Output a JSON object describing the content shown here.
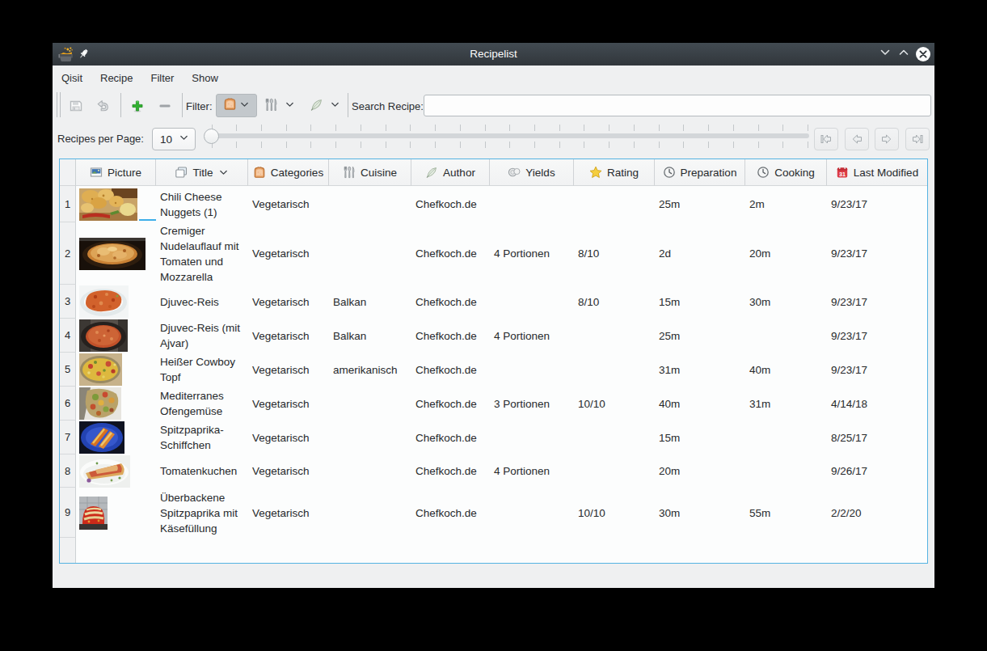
{
  "window": {
    "title": "Recipelist",
    "app_icon": "cooking-pot-icon",
    "buttons": {
      "minimize": "chevron-down-icon",
      "maximize": "chevron-up-icon",
      "close": "close-x-icon"
    }
  },
  "menu": {
    "items": [
      "Qisit",
      "Recipe",
      "Filter",
      "Show"
    ]
  },
  "toolbar": {
    "save_icon": "save-floppy-icon",
    "undo_icon": "undo-arrow-icon",
    "add_icon": "add-plus-icon",
    "remove_icon": "remove-minus-icon",
    "filter_label": "Filter:",
    "filter_buttons": [
      {
        "icon": "bread-icon",
        "pressed": true
      },
      {
        "icon": "cutlery-icon",
        "pressed": false
      },
      {
        "icon": "feather-icon",
        "pressed": false
      }
    ],
    "search_label": "Search Recipe:",
    "search_value": "",
    "search_placeholder": ""
  },
  "pager": {
    "label": "Recipes per Page:",
    "per_page_value": "10",
    "slider_value_position": 0,
    "nav_buttons": [
      "go-first-icon",
      "go-previous-icon",
      "go-next-icon",
      "go-last-icon"
    ]
  },
  "table": {
    "columns": [
      {
        "label": "Picture",
        "icon": "picture-icon"
      },
      {
        "label": "Title",
        "icon": "title-pages-icon",
        "sort_indicator": "chevron-down-icon"
      },
      {
        "label": "Categories",
        "icon": "bread-icon"
      },
      {
        "label": "Cuisine",
        "icon": "cutlery-icon"
      },
      {
        "label": "Author",
        "icon": "feather-icon"
      },
      {
        "label": "Yields",
        "icon": "plates-icon"
      },
      {
        "label": "Rating",
        "icon": "star-icon"
      },
      {
        "label": "Preparation",
        "icon": "clock-icon"
      },
      {
        "label": "Cooking",
        "icon": "clock-icon"
      },
      {
        "label": "Last Modified",
        "icon": "calendar-icon"
      }
    ],
    "rows": [
      {
        "num": "1",
        "picture": "chili-cheese-nuggets-photo",
        "title": "Chili Cheese Nuggets (1)",
        "categories": "Vegetarisch",
        "cuisine": "",
        "author": "Chefkoch.de",
        "yields": "",
        "rating": "",
        "preparation": "25m",
        "cooking": "2m",
        "last_modified": "9/23/17"
      },
      {
        "num": "2",
        "picture": "nudelauflauf-photo",
        "title": "Cremiger Nudelauflauf mit Tomaten und Mozzarella",
        "categories": "Vegetarisch",
        "cuisine": "",
        "author": "Chefkoch.de",
        "yields": "4 Portionen",
        "rating": "8/10",
        "preparation": "2d",
        "cooking": "20m",
        "last_modified": "9/23/17"
      },
      {
        "num": "3",
        "picture": "djuvec-reis-photo",
        "title": "Djuvec-Reis",
        "categories": "Vegetarisch",
        "cuisine": "Balkan",
        "author": "Chefkoch.de",
        "yields": "",
        "rating": "8/10",
        "preparation": "15m",
        "cooking": "30m",
        "last_modified": "9/23/17"
      },
      {
        "num": "4",
        "picture": "djuvec-reis-ajvar-photo",
        "title": "Djuvec-Reis (mit Ajvar)",
        "categories": "Vegetarisch",
        "cuisine": "Balkan",
        "author": "Chefkoch.de",
        "yields": "4 Portionen",
        "rating": "",
        "preparation": "25m",
        "cooking": "",
        "last_modified": "9/23/17"
      },
      {
        "num": "5",
        "picture": "cowboy-topf-photo",
        "title": "Heißer Cowboy Topf",
        "categories": "Vegetarisch",
        "cuisine": "amerikanisch",
        "author": "Chefkoch.de",
        "yields": "",
        "rating": "",
        "preparation": "31m",
        "cooking": "40m",
        "last_modified": "9/23/17"
      },
      {
        "num": "6",
        "picture": "ofengemuese-photo",
        "title": "Mediterranes Ofengemüse",
        "categories": "Vegetarisch",
        "cuisine": "",
        "author": "Chefkoch.de",
        "yields": "3 Portionen",
        "rating": "10/10",
        "preparation": "40m",
        "cooking": "31m",
        "last_modified": "4/14/18"
      },
      {
        "num": "7",
        "picture": "spitzpaprika-schiffchen-photo",
        "title": "Spitzpaprika-Schiffchen",
        "categories": "Vegetarisch",
        "cuisine": "",
        "author": "Chefkoch.de",
        "yields": "",
        "rating": "",
        "preparation": "15m",
        "cooking": "",
        "last_modified": "8/25/17"
      },
      {
        "num": "8",
        "picture": "tomatenkuchen-photo",
        "title": "Tomatenkuchen",
        "categories": "Vegetarisch",
        "cuisine": "",
        "author": "Chefkoch.de",
        "yields": "4 Portionen",
        "rating": "",
        "preparation": "20m",
        "cooking": "",
        "last_modified": "9/26/17"
      },
      {
        "num": "9",
        "picture": "spitzpaprika-kaese-photo",
        "title": "Überbackene Spitzpaprika mit Käsefüllung",
        "categories": "Vegetarisch",
        "cuisine": "",
        "author": "Chefkoch.de",
        "yields": "",
        "rating": "10/10",
        "preparation": "30m",
        "cooking": "55m",
        "last_modified": "2/2/20"
      }
    ]
  },
  "colors": {
    "titlebar": "#31363b",
    "window_background": "#eff0f1",
    "focus_blue": "#3daee9",
    "add_green": "#2fb12f",
    "star_yellow": "#f2c94c",
    "calendar_red": "#da4453"
  }
}
